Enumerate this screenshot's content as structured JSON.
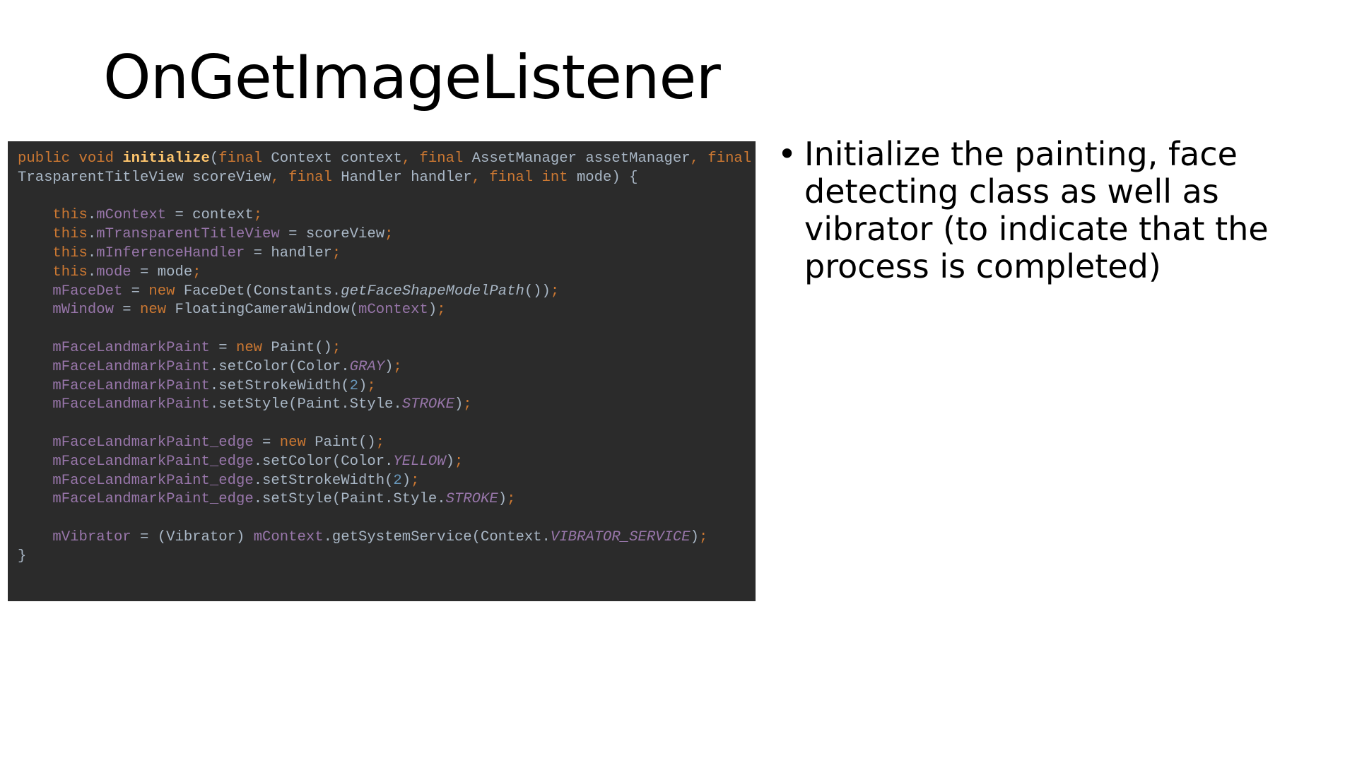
{
  "slide": {
    "title": "OnGetImageListener",
    "bullets": [
      "Initialize the painting, face detecting class as well as vibrator (to indicate that the process is completed)"
    ],
    "bullet_symbol": "•"
  },
  "code": {
    "colors": {
      "background": "#2b2b2b",
      "keyword": "#cc7832",
      "field": "#9876aa",
      "plain": "#a9b7c6",
      "method": "#ffc66d",
      "number": "#6897bb"
    },
    "lines": [
      [
        [
          "public void ",
          "k"
        ],
        [
          "initialize",
          "m"
        ],
        [
          "(",
          "n"
        ],
        [
          "final ",
          "k"
        ],
        [
          "Context context",
          "n"
        ],
        [
          ", ",
          "p"
        ],
        [
          "final ",
          "k"
        ],
        [
          "AssetManager assetManager",
          "n"
        ],
        [
          ", ",
          "p"
        ],
        [
          "final",
          "k"
        ]
      ],
      [
        [
          "TrasparentTitleView scoreView",
          "n"
        ],
        [
          ", ",
          "p"
        ],
        [
          "final ",
          "k"
        ],
        [
          "Handler handler",
          "n"
        ],
        [
          ", ",
          "p"
        ],
        [
          "final int ",
          "k"
        ],
        [
          "mode) {",
          "n"
        ]
      ],
      [],
      [
        [
          "    this",
          "k"
        ],
        [
          ".",
          "n"
        ],
        [
          "mContext",
          "f"
        ],
        [
          " = context",
          "n"
        ],
        [
          ";",
          "p"
        ]
      ],
      [
        [
          "    this",
          "k"
        ],
        [
          ".",
          "n"
        ],
        [
          "mTransparentTitleView",
          "f"
        ],
        [
          " = scoreView",
          "n"
        ],
        [
          ";",
          "p"
        ]
      ],
      [
        [
          "    this",
          "k"
        ],
        [
          ".",
          "n"
        ],
        [
          "mInferenceHandler",
          "f"
        ],
        [
          " = handler",
          "n"
        ],
        [
          ";",
          "p"
        ]
      ],
      [
        [
          "    this",
          "k"
        ],
        [
          ".",
          "n"
        ],
        [
          "mode",
          "f"
        ],
        [
          " = mode",
          "n"
        ],
        [
          ";",
          "p"
        ]
      ],
      [
        [
          "    mFaceDet",
          "f"
        ],
        [
          " = ",
          "n"
        ],
        [
          "new ",
          "k"
        ],
        [
          "FaceDet(Constants.",
          "n"
        ],
        [
          "getFaceShapeModelPath",
          "s"
        ],
        [
          "())",
          "n"
        ],
        [
          ";",
          "p"
        ]
      ],
      [
        [
          "    mWindow",
          "f"
        ],
        [
          " = ",
          "n"
        ],
        [
          "new ",
          "k"
        ],
        [
          "FloatingCameraWindow(",
          "n"
        ],
        [
          "mContext",
          "f"
        ],
        [
          ")",
          "n"
        ],
        [
          ";",
          "p"
        ]
      ],
      [],
      [
        [
          "    mFaceLandmarkPaint",
          "f"
        ],
        [
          " = ",
          "n"
        ],
        [
          "new ",
          "k"
        ],
        [
          "Paint()",
          "n"
        ],
        [
          ";",
          "p"
        ]
      ],
      [
        [
          "    mFaceLandmarkPaint",
          "f"
        ],
        [
          ".setColor(Color.",
          "n"
        ],
        [
          "GRAY",
          "i"
        ],
        [
          ")",
          "n"
        ],
        [
          ";",
          "p"
        ]
      ],
      [
        [
          "    mFaceLandmarkPaint",
          "f"
        ],
        [
          ".setStrokeWidth(",
          "n"
        ],
        [
          "2",
          "num"
        ],
        [
          ")",
          "n"
        ],
        [
          ";",
          "p"
        ]
      ],
      [
        [
          "    mFaceLandmarkPaint",
          "f"
        ],
        [
          ".setStyle(Paint.Style.",
          "n"
        ],
        [
          "STROKE",
          "i"
        ],
        [
          ")",
          "n"
        ],
        [
          ";",
          "p"
        ]
      ],
      [],
      [
        [
          "    mFaceLandmarkPaint_edge",
          "f"
        ],
        [
          " = ",
          "n"
        ],
        [
          "new ",
          "k"
        ],
        [
          "Paint()",
          "n"
        ],
        [
          ";",
          "p"
        ]
      ],
      [
        [
          "    mFaceLandmarkPaint_edge",
          "f"
        ],
        [
          ".setColor(Color.",
          "n"
        ],
        [
          "YELLOW",
          "i"
        ],
        [
          ")",
          "n"
        ],
        [
          ";",
          "p"
        ]
      ],
      [
        [
          "    mFaceLandmarkPaint_edge",
          "f"
        ],
        [
          ".setStrokeWidth(",
          "n"
        ],
        [
          "2",
          "num"
        ],
        [
          ")",
          "n"
        ],
        [
          ";",
          "p"
        ]
      ],
      [
        [
          "    mFaceLandmarkPaint_edge",
          "f"
        ],
        [
          ".setStyle(Paint.Style.",
          "n"
        ],
        [
          "STROKE",
          "i"
        ],
        [
          ")",
          "n"
        ],
        [
          ";",
          "p"
        ]
      ],
      [],
      [
        [
          "    mVibrator",
          "f"
        ],
        [
          " = (Vibrator) ",
          "n"
        ],
        [
          "mContext",
          "f"
        ],
        [
          ".getSystemService(Context.",
          "n"
        ],
        [
          "VIBRATOR_SERVICE",
          "i"
        ],
        [
          ")",
          "n"
        ],
        [
          ";",
          "p"
        ]
      ],
      [
        [
          "}",
          "n"
        ]
      ]
    ]
  }
}
